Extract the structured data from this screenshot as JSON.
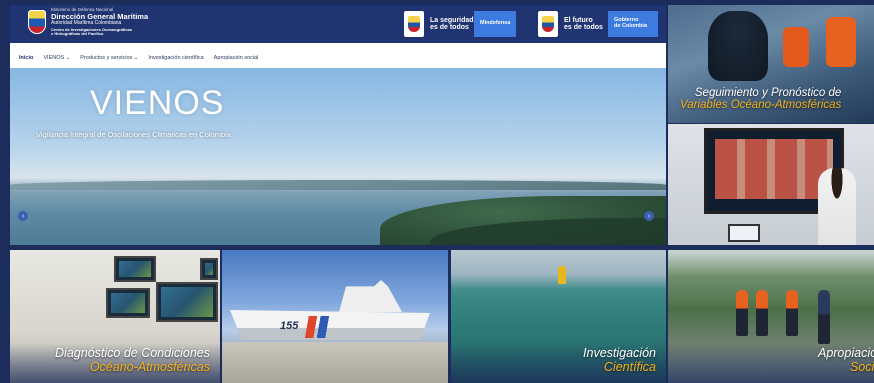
{
  "header": {
    "logo": {
      "line1": "Ministerio de Defensa Nacional",
      "line2": "Dirección General Marítima",
      "line3": "Autoridad Marítima Colombiana",
      "line4": "Centro de Investigaciones Oceanográficas",
      "line5": "e Hidrográficas del Pacífico"
    },
    "gov_left": {
      "slogan_line1": "La seguridad",
      "slogan_line2": "es de todos",
      "tag": "Mindefensa"
    },
    "gov_right": {
      "slogan_line1": "El futuro",
      "slogan_line2": "es de todos",
      "tag_line1": "Gobierno",
      "tag_line2": "de Colombia"
    }
  },
  "nav": {
    "items": [
      {
        "label": "Inicio"
      },
      {
        "label": "VIENOS ⌄"
      },
      {
        "label": "Productos y servicios ⌄"
      },
      {
        "label": "Investigación científica"
      },
      {
        "label": "Apropiación social"
      }
    ]
  },
  "hero": {
    "title": "VIENOS",
    "subtitle": "Vigilancia Integral de Oscilaciones Climáticas en Colombia",
    "prev": "‹",
    "next": "›"
  },
  "tiles": {
    "seguimiento": {
      "line1": "Seguimiento y Pronóstico de",
      "line2": "Variables Océano-Atmosféricas"
    },
    "diagnostico": {
      "line1": "Diagnóstico de Condiciones",
      "line2": "Océano-Atmosféricas"
    },
    "ship": {
      "hull_number": "155"
    },
    "investigacion": {
      "line1": "Investigación",
      "line2": "Científica"
    },
    "apropiacion": {
      "line1": "Apropiación",
      "line2": "Social"
    }
  },
  "colors": {
    "navy": "#1c2d5c",
    "header_blue": "#1f3470",
    "accent_yellow": "#f5b21a",
    "tag_blue": "#3d7be0"
  },
  "icons": [
    "colombia-shield-icon",
    "chevron-left-icon",
    "chevron-right-icon",
    "chevron-down-icon"
  ]
}
